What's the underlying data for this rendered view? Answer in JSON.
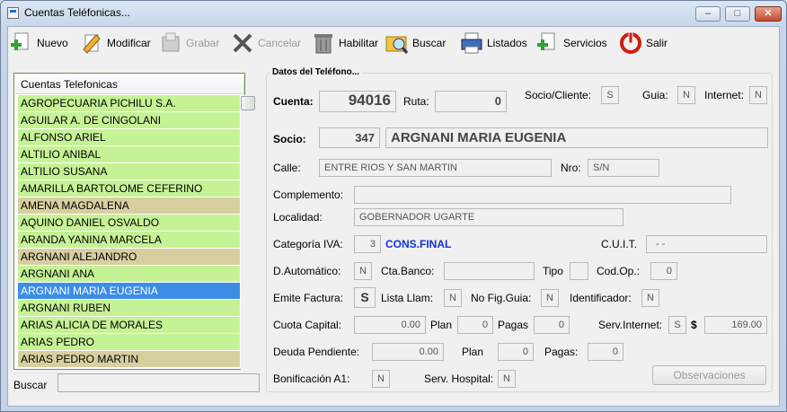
{
  "window": {
    "title": "Cuentas Teléfonicas...",
    "minimize": "–",
    "maximize": "□",
    "close": "✕"
  },
  "toolbar": {
    "nuevo": "Nuevo",
    "modificar": "Modificar",
    "grabar": "Grabar",
    "cancelar": "Cancelar",
    "habilitar": "Habilitar",
    "buscar": "Buscar",
    "listados": "Listados",
    "servicios": "Servicios",
    "salir": "Salir"
  },
  "list": {
    "header": "Cuentas Telefonicas",
    "rows": [
      {
        "name": "AGROPECUARIA PICHILU S.A.",
        "state": "green"
      },
      {
        "name": "AGUILAR A. DE CINGOLANI",
        "state": "green"
      },
      {
        "name": "ALFONSO ARIEL",
        "state": "green"
      },
      {
        "name": "ALTILIO ANIBAL",
        "state": "green"
      },
      {
        "name": "ALTILIO SUSANA",
        "state": "green"
      },
      {
        "name": "AMARILLA BARTOLOME CEFERINO",
        "state": "green"
      },
      {
        "name": "AMENA MAGDALENA",
        "state": "tan"
      },
      {
        "name": "AQUINO DANIEL OSVALDO",
        "state": "green"
      },
      {
        "name": "ARANDA YANINA MARCELA",
        "state": "green"
      },
      {
        "name": "ARGNANI ALEJANDRO",
        "state": "tan"
      },
      {
        "name": "ARGNANI ANA",
        "state": "green"
      },
      {
        "name": "ARGNANI MARIA EUGENIA",
        "state": "selected"
      },
      {
        "name": "ARGNANI RUBEN",
        "state": "green"
      },
      {
        "name": "ARIAS ALICIA DE MORALES",
        "state": "green"
      },
      {
        "name": "ARIAS PEDRO",
        "state": "green"
      },
      {
        "name": "ARIAS PEDRO MARTIN",
        "state": "tan"
      }
    ]
  },
  "search": {
    "label": "Buscar",
    "value": ""
  },
  "details": {
    "group_title": "Datos del Teléfono...",
    "cuenta_label": "Cuenta:",
    "cuenta": "94016",
    "ruta_label": "Ruta:",
    "ruta": "0",
    "socio_cliente_label": "Socio/Cliente:",
    "socio_cliente": "S",
    "guia_label": "Guia:",
    "guia": "N",
    "internet_label": "Internet:",
    "internet": "N",
    "socio_label": "Socio:",
    "socio_num": "347",
    "socio_nombre": "ARGNANI MARIA EUGENIA",
    "calle_label": "Calle:",
    "calle": "ENTRE RIOS Y SAN MARTIN",
    "nro_label": "Nro:",
    "nro": "S/N",
    "complemento_label": "Complemento:",
    "complemento": "",
    "localidad_label": "Localidad:",
    "localidad": "GOBERNADOR UGARTE",
    "categoria_label": "Categoría IVA:",
    "categoria_num": "3",
    "categoria_desc": "CONS.FINAL",
    "cuit_label": "C.U.I.T.",
    "cuit": "-       -",
    "dautomatico_label": "D.Automático:",
    "dautomatico": "N",
    "ctabanco_label": "Cta.Banco:",
    "ctabanco": "",
    "tipo_label": "Tipo",
    "tipo": "",
    "codop_label": "Cod.Op.:",
    "codop": "0",
    "emite_label": "Emite Factura:",
    "emite": "S",
    "listallam_label": "Lista Llam:",
    "listallam": "N",
    "nofig_label": "No Fig.Guia:",
    "nofig": "N",
    "identificador_label": "Identificador:",
    "identificador": "N",
    "cuota_label": "Cuota Capital:",
    "cuota": "0.00",
    "plan1_label": "Plan",
    "plan1": "0",
    "pagas1_label": "Pagas",
    "pagas1": "0",
    "servinternet_label": "Serv.Internet:",
    "servinternet": "S",
    "dollar": "$",
    "servinternet_monto": "169.00",
    "deuda_label": "Deuda Pendiente:",
    "deuda": "0.00",
    "plan2_label": "Plan",
    "plan2": "0",
    "pagas2_label": "Pagas:",
    "pagas2": "0",
    "bonif_label": "Bonificación A1:",
    "bonif": "N",
    "servhosp_label": "Serv. Hospital:",
    "servhosp": "N",
    "observaciones": "Observaciones"
  }
}
